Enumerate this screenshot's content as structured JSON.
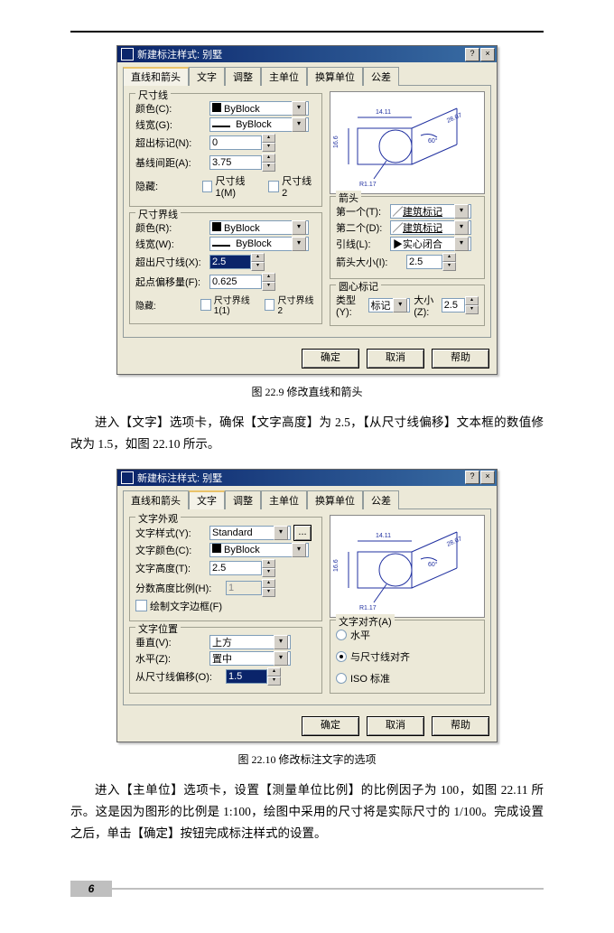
{
  "page_number": "6",
  "fig1": {
    "caption": "图 22.9  修改直线和箭头",
    "dialog_title": "新建标注样式: 别墅",
    "tabs": [
      "直线和箭头",
      "文字",
      "调整",
      "主单位",
      "换算单位",
      "公差"
    ],
    "active_tab": 0,
    "group_dimline": {
      "title": "尺寸线",
      "color_label": "颜色(C):",
      "color_value": "ByBlock",
      "lw_label": "线宽(G):",
      "lw_value": "ByBlock",
      "ext_label": "超出标记(N):",
      "ext_value": "0",
      "baseline_label": "基线间距(A):",
      "baseline_value": "3.75",
      "hide_label": "隐藏:",
      "hide_dim1": "尺寸线 1(M)",
      "hide_dim2": "尺寸线 2"
    },
    "group_extline": {
      "title": "尺寸界线",
      "color_label": "颜色(R):",
      "color_value": "ByBlock",
      "lw_label": "线宽(W):",
      "lw_value": "ByBlock",
      "ext_label": "超出尺寸线(X):",
      "ext_value": "2.5",
      "origin_label": "起点偏移量(F):",
      "origin_value": "0.625",
      "hide_label": "隐藏:",
      "hide_ext1": "尺寸界线 1(1)",
      "hide_ext2": "尺寸界线 2"
    },
    "group_arrow": {
      "title": "箭头",
      "first_label": "第一个(T):",
      "first_value": "建筑标记",
      "second_label": "第二个(D):",
      "second_value": "建筑标记",
      "leader_label": "引线(L):",
      "leader_value": "实心闭合",
      "size_label": "箭头大小(I):",
      "size_value": "2.5"
    },
    "group_center": {
      "title": "圆心标记",
      "type_label": "类型(Y):",
      "type_value": "标记",
      "size_label": "大小(Z):",
      "size_value": "2.5"
    },
    "buttons": {
      "ok": "确定",
      "cancel": "取消",
      "help": "帮助"
    },
    "preview_labels": {
      "top": "14.11",
      "left": "16.6",
      "r": "R1.17",
      "ang": "60°",
      "diag": "28.07"
    }
  },
  "para1": {
    "text": "进入【文字】选项卡，确保【文字高度】为 2.5，【从尺寸线偏移】文本框的数值修改为 1.5，如图 22.10 所示。"
  },
  "fig2": {
    "caption": "图 22.10  修改标注文字的选项",
    "dialog_title": "新建标注样式: 别墅",
    "tabs": [
      "直线和箭头",
      "文字",
      "调整",
      "主单位",
      "换算单位",
      "公差"
    ],
    "active_tab": 1,
    "group_appearance": {
      "title": "文字外观",
      "style_label": "文字样式(Y):",
      "style_value": "Standard",
      "style_btn": "...",
      "color_label": "文字颜色(C):",
      "color_value": "ByBlock",
      "height_label": "文字高度(T):",
      "height_value": "2.5",
      "frac_label": "分数高度比例(H):",
      "frac_value": "1",
      "frame_label": "绘制文字边框(F)"
    },
    "group_placement": {
      "title": "文字位置",
      "vert_label": "垂直(V):",
      "vert_value": "上方",
      "horiz_label": "水平(Z):",
      "horiz_value": "置中",
      "offset_label": "从尺寸线偏移(O):",
      "offset_value": "1.5"
    },
    "group_align": {
      "title": "文字对齐(A)",
      "opt1": "水平",
      "opt2": "与尺寸线对齐",
      "opt3": "ISO 标准",
      "selected": 1
    },
    "buttons": {
      "ok": "确定",
      "cancel": "取消",
      "help": "帮助"
    },
    "preview_labels": {
      "top": "14.11",
      "left": "16.6",
      "r": "R1.17",
      "ang": "60°",
      "diag": "28.07"
    }
  },
  "para2": {
    "text": "进入【主单位】选项卡，设置【测量单位比例】的比例因子为 100，如图 22.11 所示。这是因为图形的比例是 1:100，绘图中采用的尺寸将是实际尺寸的 1/100。完成设置之后，单击【确定】按钮完成标注样式的设置。"
  }
}
